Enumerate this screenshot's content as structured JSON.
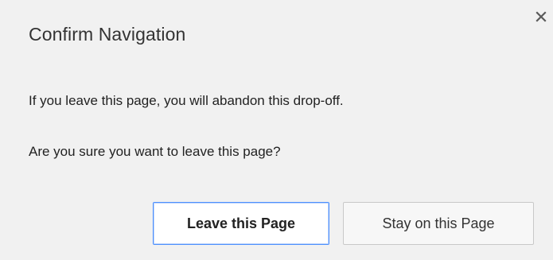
{
  "dialog": {
    "title": "Confirm Navigation",
    "close_icon": "close-icon",
    "messages": [
      "If you leave this page, you will abandon this drop-off.",
      "Are you sure you want to leave this page?"
    ],
    "buttons": {
      "leave_label": "Leave this Page",
      "stay_label": "Stay on this Page"
    }
  },
  "colors": {
    "background": "#f1f1f1",
    "focus_border": "#4d90fe"
  }
}
